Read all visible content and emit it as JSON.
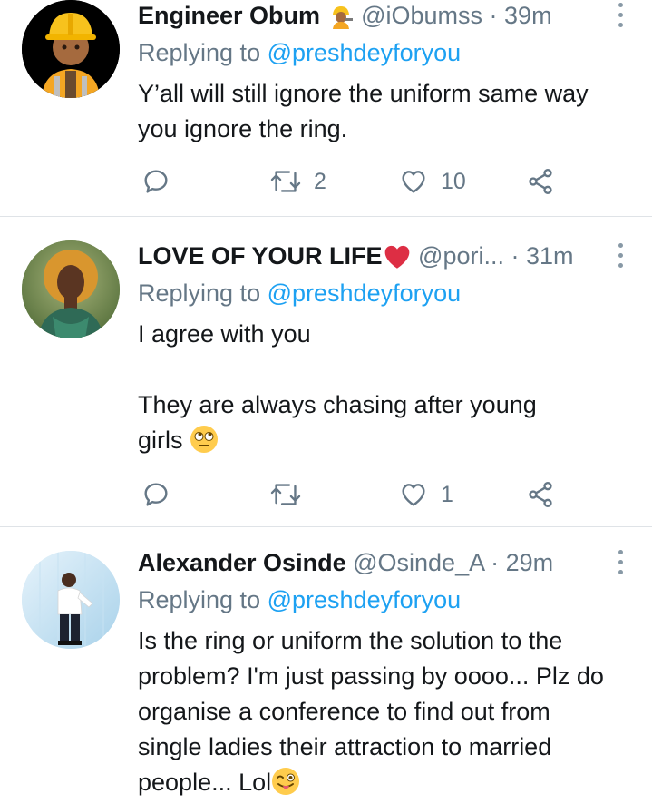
{
  "tweets": [
    {
      "name": "Engineer Obum",
      "name_emoji": "construction-worker-emoji",
      "handle": "@iObumss",
      "sep": "·",
      "time": "39m",
      "replying_label": "Replying to",
      "replying_to": "@preshdeyforyou",
      "text": [
        "Y’all will still ignore the uniform same way you ignore the ring."
      ],
      "retweets": "2",
      "likes": "10"
    },
    {
      "name": "LOVE OF YOUR LIFE",
      "name_emoji": "red-heart-emoji",
      "handle": "@pori...",
      "sep": "·",
      "time": "31m",
      "replying_label": "Replying to",
      "replying_to": "@preshdeyforyou",
      "text": [
        "I agree with you",
        "They are always chasing after young",
        "girls"
      ],
      "text_emoji": "eye-roll-emoji",
      "retweets": "",
      "likes": "1"
    },
    {
      "name": "Alexander Osinde",
      "handle": "@Osinde_A",
      "sep": "·",
      "time": "29m",
      "replying_label": "Replying to",
      "replying_to": "@preshdeyforyou",
      "text": [
        "Is the ring or uniform the solution to the problem? I'm just passing by oooo... Plz do organise a conference to find out from single ladies their attraction to married people... Lol"
      ],
      "text_emoji": "winking-tongue-emoji"
    }
  ],
  "colors": {
    "text": "#14171a",
    "secondary": "#657786",
    "link": "#1da1f2",
    "divider": "#dfe3e7"
  }
}
